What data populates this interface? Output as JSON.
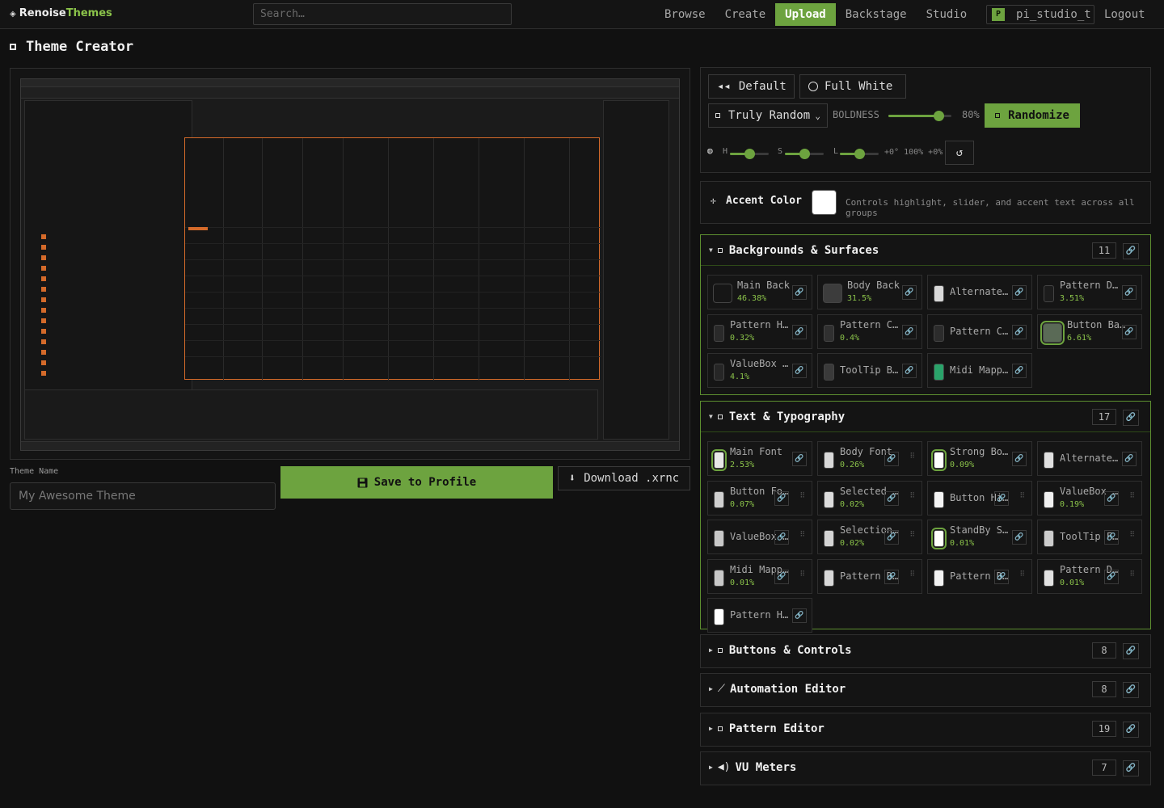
{
  "nav": {
    "logo_main": "Renoise",
    "logo_accent": "Themes",
    "search_placeholder": "Search…",
    "links": [
      "Browse",
      "Create",
      "Upload",
      "Backstage",
      "Studio"
    ],
    "active_link": "Upload",
    "user_badge": "P",
    "username": "pi_studio_t",
    "logout": "Logout"
  },
  "page": {
    "title": "Theme Creator",
    "theme_name_label": "Theme Name",
    "theme_name_placeholder": "My Awesome Theme",
    "save_label": "Save to Profile",
    "download_label": "Download .xrnc"
  },
  "controls": {
    "default_label": "Default",
    "full_white_label": "Full White",
    "mode_value": "Truly Random",
    "boldness_label": "BOLDNESS",
    "boldness_value": "80%",
    "boldness_fraction": 0.8,
    "randomize_label": "Randomize",
    "h_label": "H",
    "s_label": "S",
    "l_label": "L",
    "h_fraction": 0.5,
    "s_fraction": 0.5,
    "l_fraction": 0.5,
    "hsl_readout": "+0° 100% +0%"
  },
  "accent": {
    "title": "Accent Color",
    "color": "#ffffff",
    "description": "Controls highlight, slider, and accent text across all groups"
  },
  "groups": {
    "backgrounds": {
      "title": "Backgrounds & Surfaces",
      "count": "11",
      "items": [
        {
          "name": "Main Back",
          "pct": "46.38%",
          "color": "#161616"
        },
        {
          "name": "Body Back",
          "pct": "31.5%",
          "color": "#3c3c3c"
        },
        {
          "name": "Alternate Back",
          "pct": "",
          "color": "#d8d8d8"
        },
        {
          "name": "Pattern Default Back",
          "pct": "3.51%",
          "color": "#1c1c1c"
        },
        {
          "name": "Pattern Highlighted Back",
          "pct": "0.32%",
          "color": "#2a2a2a"
        },
        {
          "name": "Pattern Centerbar Back",
          "pct": "0.4%",
          "color": "#303030"
        },
        {
          "name": "Pattern Centerbar Back Standby",
          "pct": "",
          "color": "#2c2c2c"
        },
        {
          "name": "Button Back",
          "pct": "6.61%",
          "color": "#5a6a56"
        },
        {
          "name": "ValueBox Back",
          "pct": "4.1%",
          "color": "#262626"
        },
        {
          "name": "ToolTip Back",
          "pct": "",
          "color": "#3a3a3a"
        },
        {
          "name": "Midi Mapping Back",
          "pct": "",
          "color": "#2aa36a"
        }
      ]
    },
    "text": {
      "title": "Text & Typography",
      "count": "17",
      "items": [
        {
          "name": "Main Font",
          "pct": "2.53%",
          "color": "#e8e8e8"
        },
        {
          "name": "Body Font",
          "pct": "0.26%",
          "color": "#d8d8d8"
        },
        {
          "name": "Strong Body Font",
          "pct": "0.09%",
          "color": "#ffffff"
        },
        {
          "name": "Alternate Main Font",
          "pct": "",
          "color": "#e0e0e0"
        },
        {
          "name": "Button Font",
          "pct": "0.07%",
          "color": "#cfcfcf"
        },
        {
          "name": "Selected Button Font",
          "pct": "0.02%",
          "color": "#dcdcdc"
        },
        {
          "name": "Button Highlight Font",
          "pct": "",
          "color": "#f4f4f4"
        },
        {
          "name": "ValueBox Font",
          "pct": "0.19%",
          "color": "#f0f0f0"
        },
        {
          "name": "ValueBox Font Icons",
          "pct": "",
          "color": "#c8c8c8"
        },
        {
          "name": "Selection Font",
          "pct": "0.02%",
          "color": "#d4d4d4"
        },
        {
          "name": "StandBy Selection Font",
          "pct": "0.01%",
          "color": "#ffffff"
        },
        {
          "name": "ToolTip Font",
          "pct": "",
          "color": "#cccccc"
        },
        {
          "name": "Midi Mapping Font",
          "pct": "0.01%",
          "color": "#c8c8c8"
        },
        {
          "name": "Pattern Default Font",
          "pct": "",
          "color": "#d8d8d8"
        },
        {
          "name": "Pattern Default Font Volume",
          "pct": "",
          "color": "#f2f2f2"
        },
        {
          "name": "Pattern Default Font Panning",
          "pct": "0.01%",
          "color": "#e2e2e2"
        },
        {
          "name": "Pattern Highlighted Font",
          "pct": "",
          "color": "#ffffff"
        }
      ]
    },
    "buttons": {
      "title": "Buttons & Controls",
      "count": "8"
    },
    "automation": {
      "title": "Automation Editor",
      "count": "8"
    },
    "pattern": {
      "title": "Pattern Editor",
      "count": "19"
    },
    "vu": {
      "title": "VU Meters",
      "count": "7"
    }
  },
  "icons": {
    "default": "back-arrow-icon",
    "full_white": "circle-icon",
    "reset": "reset-icon",
    "accent": "sparkle-icon",
    "save": "floppy-icon",
    "download": "download-arrow-icon",
    "link": "link-icon"
  },
  "colors": {
    "accent_green": "#6da33f",
    "active_border": "#5d8f30",
    "orange": "#d46a2a"
  }
}
